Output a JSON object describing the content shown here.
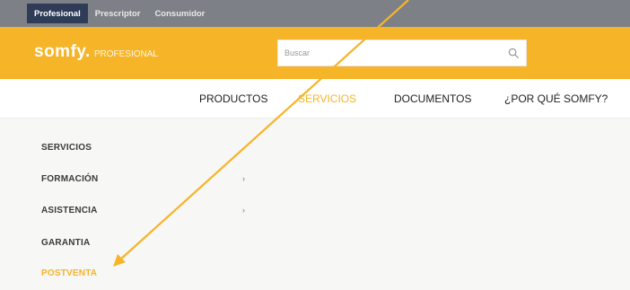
{
  "audience_tabs": [
    {
      "label": "Profesional",
      "active": true
    },
    {
      "label": "Prescriptor",
      "active": false
    },
    {
      "label": "Consumidor",
      "active": false
    }
  ],
  "logo": {
    "brand": "somfy.",
    "sub": "PROFESIONAL"
  },
  "search": {
    "placeholder": "Buscar",
    "icon": "search-icon"
  },
  "main_nav": [
    {
      "label": "PRODUCTOS",
      "active": false
    },
    {
      "label": "SERVICIOS",
      "active": true
    },
    {
      "label": "DOCUMENTOS",
      "active": false
    },
    {
      "label": "¿POR QUÉ SOMFY?",
      "active": false
    }
  ],
  "side_menu": [
    {
      "label": "SERVICIOS",
      "has_submenu": false,
      "active": false
    },
    {
      "label": "FORMACIÓN",
      "has_submenu": true,
      "active": false
    },
    {
      "label": "ASISTENCIA",
      "has_submenu": true,
      "active": false
    },
    {
      "label": "GARANTIA",
      "has_submenu": false,
      "active": false
    },
    {
      "label": "POSTVENTA",
      "has_submenu": false,
      "active": true
    }
  ],
  "colors": {
    "accent": "#f6b428",
    "topbar": "#7d8187",
    "active_tab": "#2f3b57",
    "arrow": "#f6b428"
  }
}
